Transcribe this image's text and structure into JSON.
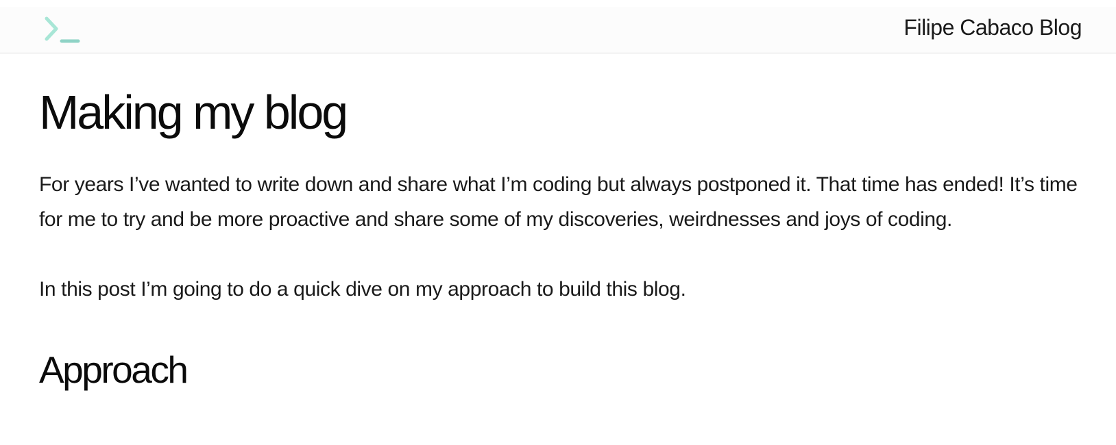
{
  "header": {
    "logo_icon": "terminal-prompt-icon",
    "logo_colors": {
      "chevron": "#a8e6d6",
      "underscore": "#8fd3c6"
    },
    "site_title": "Filipe Cabaco Blog"
  },
  "post": {
    "title": "Making my blog",
    "paragraphs": [
      "For years I’ve wanted to write down and share what I’m coding but always postponed it. That time has ended! It’s time for me to try and be more proactive and share some of my discoveries, weirdnesses and joys of coding.",
      "In this post I’m going to do a quick dive on my approach to build this blog."
    ],
    "section_heading": "Approach"
  }
}
